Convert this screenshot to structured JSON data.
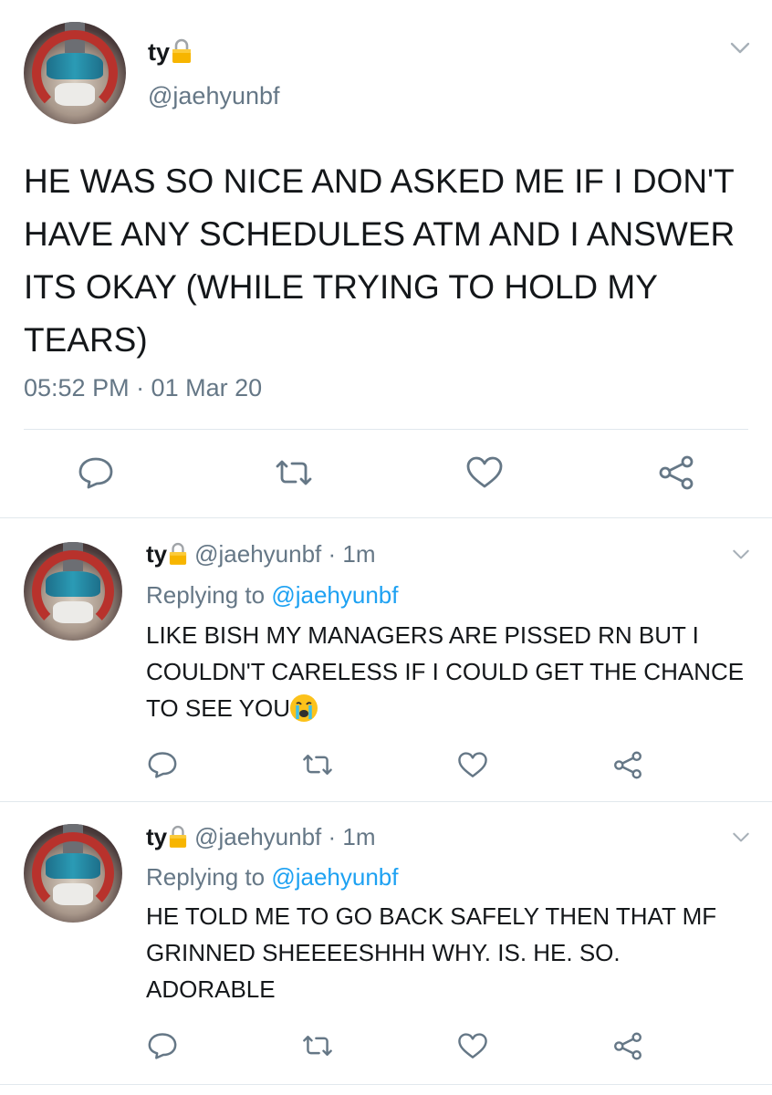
{
  "main_tweet": {
    "display_name": "ty",
    "handle": "@jaehyunbf",
    "text": "HE WAS SO NICE AND ASKED ME IF I DON'T HAVE ANY SCHEDULES ATM AND I ANSWER ITS OKAY (WHILE TRYING TO HOLD MY TEARS)",
    "timestamp": "05:52 PM · 01 Mar 20"
  },
  "replies": [
    {
      "display_name": "ty",
      "handle_time": "@jaehyunbf · 1m",
      "replying_prefix": "Replying to ",
      "replying_to": "@jaehyunbf",
      "text": "LIKE BISH MY MANAGERS ARE PISSED RN BUT I COULDN'T CARELESS IF I COULD GET THE CHANCE TO SEE YOU",
      "emoji": "loudly-crying-face-emoji"
    },
    {
      "display_name": "ty",
      "handle_time": "@jaehyunbf · 1m",
      "replying_prefix": "Replying to ",
      "replying_to": "@jaehyunbf",
      "text": "HE TOLD ME TO GO BACK SAFELY THEN THAT MF GRINNED SHEEEESHHH WHY. IS. HE. SO. ADORABLE"
    }
  ],
  "icons": {
    "lock": "lock-icon",
    "chevron": "chevron-down-icon",
    "reply": "reply-icon",
    "retweet": "retweet-icon",
    "like": "heart-icon",
    "share": "share-icon"
  },
  "colors": {
    "text": "#14171a",
    "secondary": "#657786",
    "link": "#1da1f2",
    "divider": "#e1e8ed",
    "icon": "#657786"
  }
}
